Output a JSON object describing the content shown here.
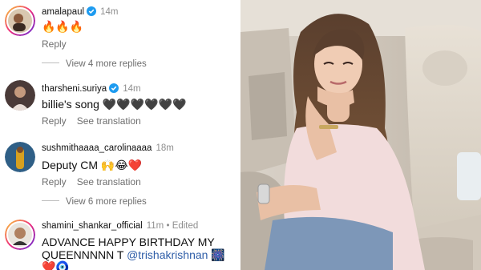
{
  "comments": [
    {
      "username": "amalapaul",
      "verified": true,
      "time": "14m",
      "text": "🔥🔥🔥",
      "actions": [
        "Reply"
      ],
      "more_replies": "View 4 more replies"
    },
    {
      "username": "tharsheni.suriya",
      "verified": true,
      "time": "14m",
      "text": "billie's song 🖤🖤🖤🖤🖤🖤",
      "actions": [
        "Reply",
        "See translation"
      ]
    },
    {
      "username": "sushmithaaaa_carolinaaaa",
      "verified": false,
      "time": "18m",
      "text": "Deputy CM 🙌😂❤️",
      "actions": [
        "Reply",
        "See translation"
      ],
      "more_replies": "View 6 more replies"
    },
    {
      "username": "shamini_shankar_official",
      "verified": false,
      "time": "11m",
      "edited": "• Edited",
      "text_line1": "ADVANCE HAPPY BIRTHDAY MY",
      "text_line2_prefix": "QUEENNNNN T ",
      "mention": "@trishakrishnan",
      "text_line2_suffix": " 🎆",
      "text_line3": "❤️🧿"
    }
  ],
  "colors": {
    "verified_badge": "#1d9bf0",
    "mention": "#2f5ea8",
    "secondary_text": "#8e8e8e"
  }
}
